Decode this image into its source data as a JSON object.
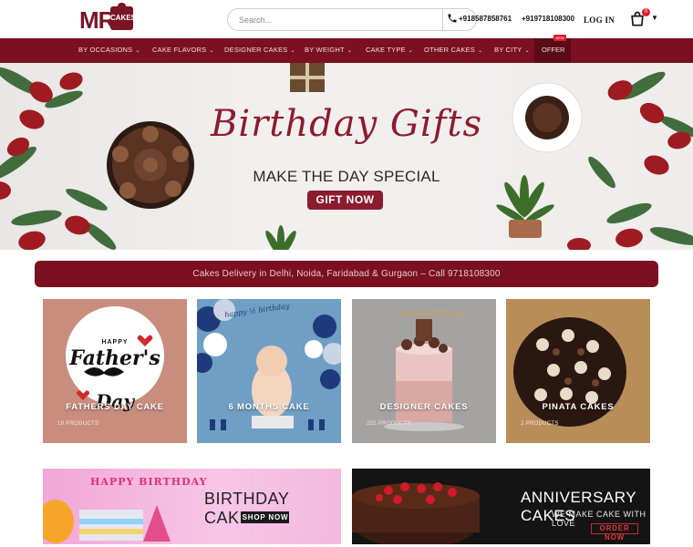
{
  "header": {
    "logo_text": "MR",
    "logo_badge": "CAKES",
    "search_placeholder": "Search...",
    "phone_1": "+918587858761",
    "phone_2": "+919718108300",
    "login_label": "LOG IN",
    "cart_count": "0"
  },
  "nav": {
    "items": [
      {
        "label": "BY OCCASIONS"
      },
      {
        "label": "CAKE FLAVORS"
      },
      {
        "label": "DESIGNER CAKES"
      },
      {
        "label": "BY WEIGHT"
      },
      {
        "label": "CAKE TYPE"
      },
      {
        "label": "OTHER CAKES"
      },
      {
        "label": "BY CITY"
      }
    ],
    "offer_label": "OFFER",
    "new_badge": "NEW"
  },
  "hero": {
    "title": "Birthday Gifts",
    "subtitle": "MAKE THE DAY SPECIAL",
    "button_label": "GIFT NOW"
  },
  "info_bar": {
    "text": "Cakes Delivery in Delhi, Noida, Faridabad & Gurgaon – Call 9718108300"
  },
  "categories": [
    {
      "title": "FATHERS DAY CAKE",
      "count": "19 PRODUCTS",
      "image_text_1": "HAPPY",
      "image_text_2": "Father's",
      "image_text_3": "Day"
    },
    {
      "title": "6 MONTHS CAKE",
      "count": "",
      "image_text_1": "happy ½ birthday"
    },
    {
      "title": "DESIGNER CAKES",
      "count": "255 PRODUCTS",
      "image_text_1": "Happy Birthday"
    },
    {
      "title": "PINATA CAKES",
      "count": "2 PRODUCTS"
    }
  ],
  "banners": {
    "birthday": {
      "title": "BIRTHDAY CAKES",
      "button": "SHOP NOW",
      "image_text": "HAPPY BIRTHDAY"
    },
    "anniversary": {
      "title": "ANNIVERSARY CAKES",
      "subtitle": "WE MAKE CAKE WITH LOVE",
      "button": "ORDER NOW"
    }
  },
  "colors": {
    "brand_maroon": "#7b1020",
    "hero_title": "#8c1c2e",
    "badge_red": "#e01e2a"
  }
}
